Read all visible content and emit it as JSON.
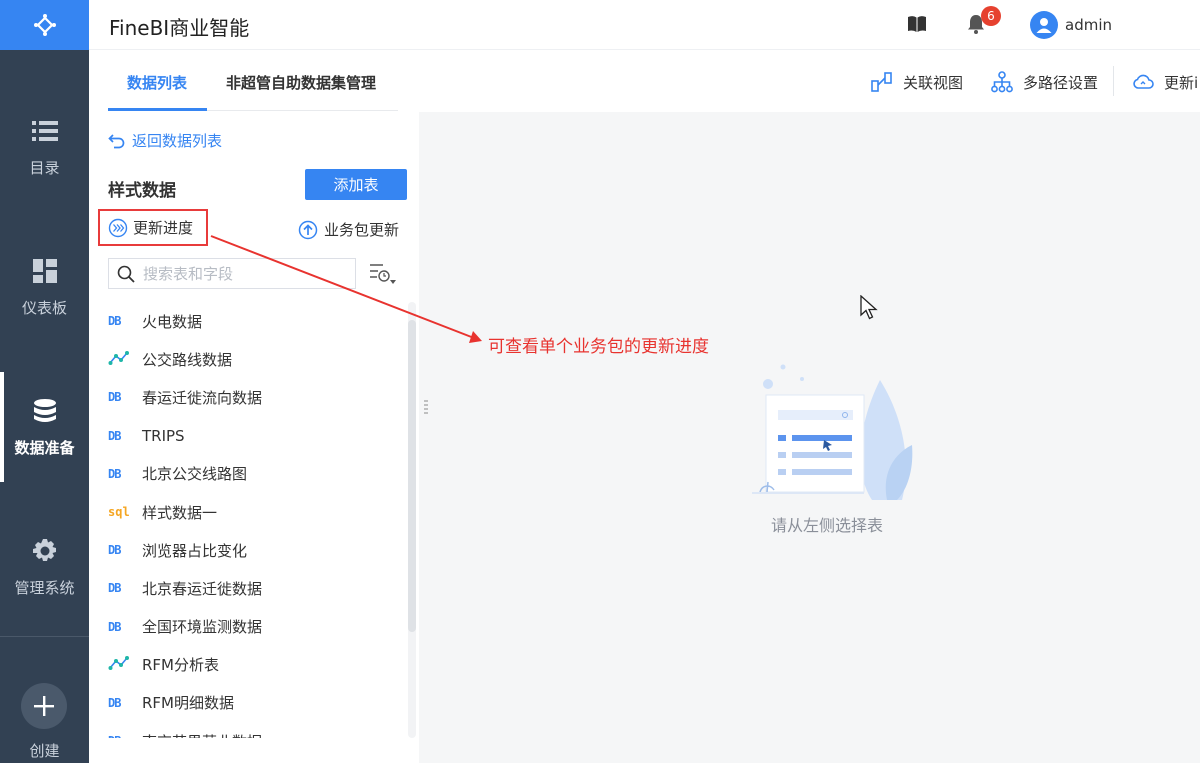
{
  "app": {
    "title": "FineBI商业智能"
  },
  "header": {
    "notification_count": "6",
    "username": "admin"
  },
  "nav": {
    "items": [
      {
        "label": "目录",
        "icon": "list-icon"
      },
      {
        "label": "仪表板",
        "icon": "dashboard-icon"
      },
      {
        "label": "数据准备",
        "icon": "database-icon",
        "active": true
      },
      {
        "label": "管理系统",
        "icon": "gear-icon"
      }
    ],
    "create_label": "创建"
  },
  "tabs": [
    {
      "label": "数据列表",
      "active": true
    },
    {
      "label": "非超管自助数据集管理",
      "active": false
    }
  ],
  "toolbar": {
    "relation_view": "关联视图",
    "multipath": "多路径设置",
    "update": "更新i"
  },
  "panel": {
    "back_label": "返回数据列表",
    "pack_name": "样式数据",
    "add_table": "添加表",
    "update_progress": "更新进度",
    "pack_update": "业务包更新",
    "search_placeholder": "搜索表和字段"
  },
  "tables": [
    {
      "tag": "DB",
      "kind": "db",
      "name": "火电数据"
    },
    {
      "tag": "",
      "kind": "etl",
      "name": "公交路线数据"
    },
    {
      "tag": "DB",
      "kind": "db",
      "name": "春运迁徙流向数据"
    },
    {
      "tag": "DB",
      "kind": "db",
      "name": "TRIPS"
    },
    {
      "tag": "DB",
      "kind": "db",
      "name": "北京公交线路图"
    },
    {
      "tag": "sql",
      "kind": "sql",
      "name": "样式数据一"
    },
    {
      "tag": "DB",
      "kind": "db",
      "name": "浏览器占比变化"
    },
    {
      "tag": "DB",
      "kind": "db",
      "name": "北京春运迁徙数据"
    },
    {
      "tag": "DB",
      "kind": "db",
      "name": "全国环境监测数据"
    },
    {
      "tag": "",
      "kind": "etl",
      "name": "RFM分析表"
    },
    {
      "tag": "DB",
      "kind": "db",
      "name": "RFM明细数据"
    },
    {
      "tag": "DB",
      "kind": "db",
      "name": "南京苏果营业数据"
    }
  ],
  "annotation": "可查看单个业务包的更新进度",
  "empty_state": "请从左侧选择表",
  "colors": {
    "accent": "#3685f2",
    "nav_bg": "#324153",
    "annotation_red": "#e8332f",
    "sql_orange": "#f5a623"
  }
}
